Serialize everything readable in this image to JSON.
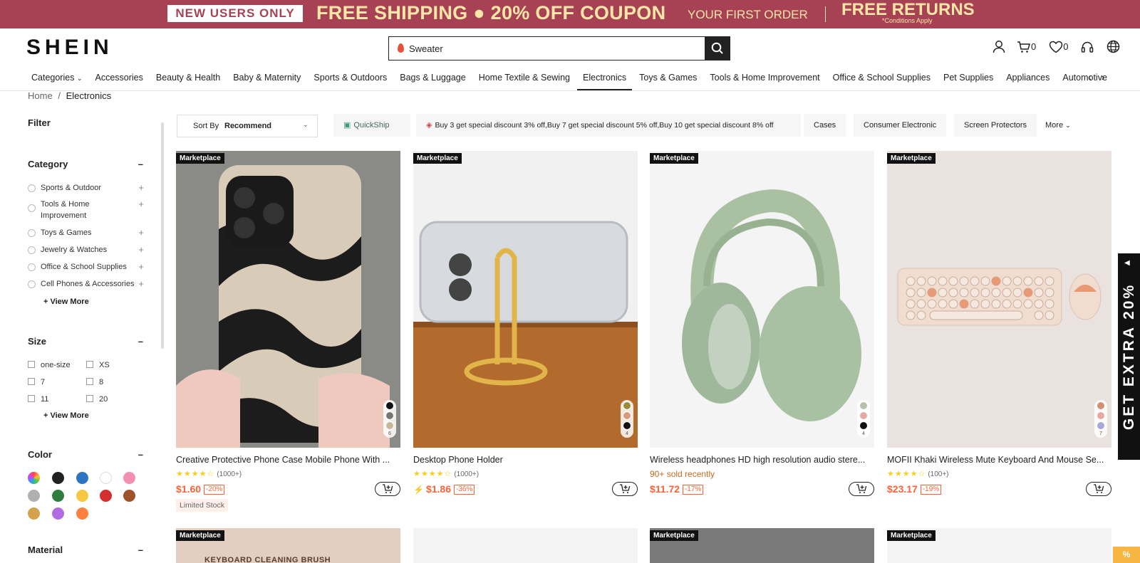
{
  "promo": {
    "new_users": "NEW USERS ONLY",
    "free_shipping": "FREE SHIPPING ● 20% OFF COUPON",
    "first_order": "YOUR FIRST ORDER",
    "free_returns": "FREE RETURNS",
    "conditions": "*Conditions Apply"
  },
  "header": {
    "logo": "SHEIN",
    "search_value": "Sweater",
    "cart_count": "0",
    "wishlist_count": "0"
  },
  "catnav": {
    "items": [
      "Categories",
      "Accessories",
      "Beauty & Health",
      "Baby & Maternity",
      "Sports & Outdoors",
      "Bags & Luggage",
      "Home Textile & Sewing",
      "Electronics",
      "Toys & Games",
      "Tools & Home Improvement",
      "Office & School Supplies",
      "Pet Supplies",
      "Appliances",
      "Automotive"
    ],
    "active": "Electronics"
  },
  "breadcrumb": {
    "home": "Home",
    "sep": "/",
    "current": "Electronics"
  },
  "sidebar": {
    "filter": "Filter",
    "category_title": "Category",
    "categories": [
      "Sports & Outdoor",
      "Tools & Home Improvement",
      "Toys & Games",
      "Jewelry & Watches",
      "Office & School Supplies",
      "Cell Phones & Accessories"
    ],
    "view_more": "+ View More",
    "size_title": "Size",
    "sizes": [
      "one-size",
      "XS",
      "7",
      "8",
      "11",
      "20"
    ],
    "color_title": "Color",
    "colors": [
      "#222222",
      "#2f74c0",
      "#ffffff",
      "#f48fb1",
      "#b0b0b0",
      "#2e7d3e",
      "#f5c842",
      "#d32f2f",
      "#a0522d",
      "#d4a24c",
      "#b06ce0",
      "#ff7f3f"
    ],
    "material_title": "Material"
  },
  "filterbar": {
    "sort_label": "Sort By",
    "sort_value": "Recommend",
    "quickship": "QuickShip",
    "discount": "Buy 3 get special discount 3% off,Buy 7 get special discount 5% off,Buy 10 get special discount 8% off",
    "chips": [
      "Cases",
      "Consumer Electronic",
      "Screen Protectors"
    ],
    "more": "More"
  },
  "products": [
    {
      "tag": "Marketplace",
      "title": "Creative Protective Phone Case Mobile Phone With ...",
      "stars": "★★★★☆",
      "reviews": "(1000+)",
      "price": "$1.60",
      "discount": "-20%",
      "extra": "Limited Stock",
      "swatch_count": "6"
    },
    {
      "tag": "Marketplace",
      "title": "Desktop Phone Holder",
      "stars": "★★★★☆",
      "reviews": "(1000+)",
      "price": "$1.86",
      "discount": "-36%",
      "swatch_count": "4"
    },
    {
      "tag": "Marketplace",
      "title": "Wireless headphones HD high resolution audio stere...",
      "sold": "90+ sold recently",
      "price": "$11.72",
      "discount": "-17%",
      "swatch_count": "4"
    },
    {
      "tag": "Marketplace",
      "title": "MOFII Khaki Wireless Mute Keyboard And Mouse Se...",
      "stars": "★★★★☆",
      "reviews": "(100+)",
      "price": "$23.17",
      "discount": "-19%",
      "swatch_count": "7"
    }
  ],
  "row2": {
    "tags": [
      "Marketplace",
      "Marketplace",
      "Marketplace"
    ],
    "keyboard_text": "KEYBOARD CLEANING BRUSH"
  },
  "side_banner": {
    "text": "GET EXTRA 20%",
    "badge": "%"
  }
}
